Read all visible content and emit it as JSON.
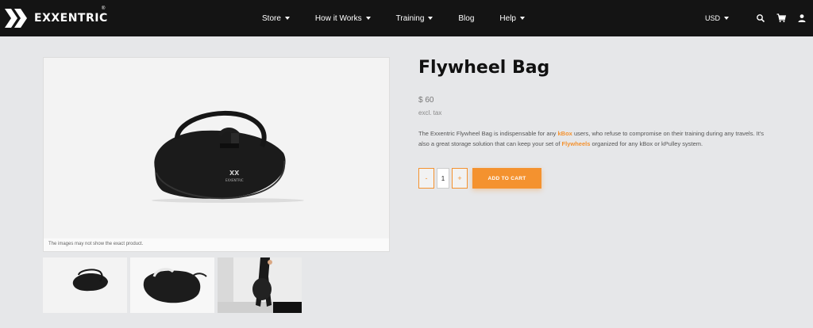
{
  "brand": {
    "name": "EXXENTRIC",
    "reg": "®"
  },
  "nav": {
    "items": [
      {
        "label": "Store",
        "has_dropdown": true
      },
      {
        "label": "How it Works",
        "has_dropdown": true
      },
      {
        "label": "Training",
        "has_dropdown": true
      },
      {
        "label": "Blog",
        "has_dropdown": false
      },
      {
        "label": "Help",
        "has_dropdown": true
      }
    ],
    "currency": "USD",
    "icons": [
      "search-icon",
      "cart-icon",
      "user-icon"
    ]
  },
  "gallery": {
    "caption": "The images may not show the exact product.",
    "thumbnails": [
      "thumbnail-1",
      "thumbnail-2",
      "thumbnail-3"
    ]
  },
  "product": {
    "title": "Flywheel Bag",
    "price": "$ 60",
    "tax_note": "excl. tax",
    "description": {
      "part1": "The Exxentric Flywheel Bag is indispensable for any ",
      "link1": "kBox",
      "part2": " users, who refuse to compromise on their training during any travels. It's also a great storage solution that can keep your set of ",
      "link2": "Flywheels",
      "part3": " organized for any kBox or kPulley system."
    },
    "quantity": "1",
    "decrement_label": "-",
    "increment_label": "+",
    "add_to_cart_label": "ADD TO CART"
  },
  "colors": {
    "accent": "#f4922f",
    "header_bg": "#141414",
    "page_bg": "#e6e7e9"
  }
}
